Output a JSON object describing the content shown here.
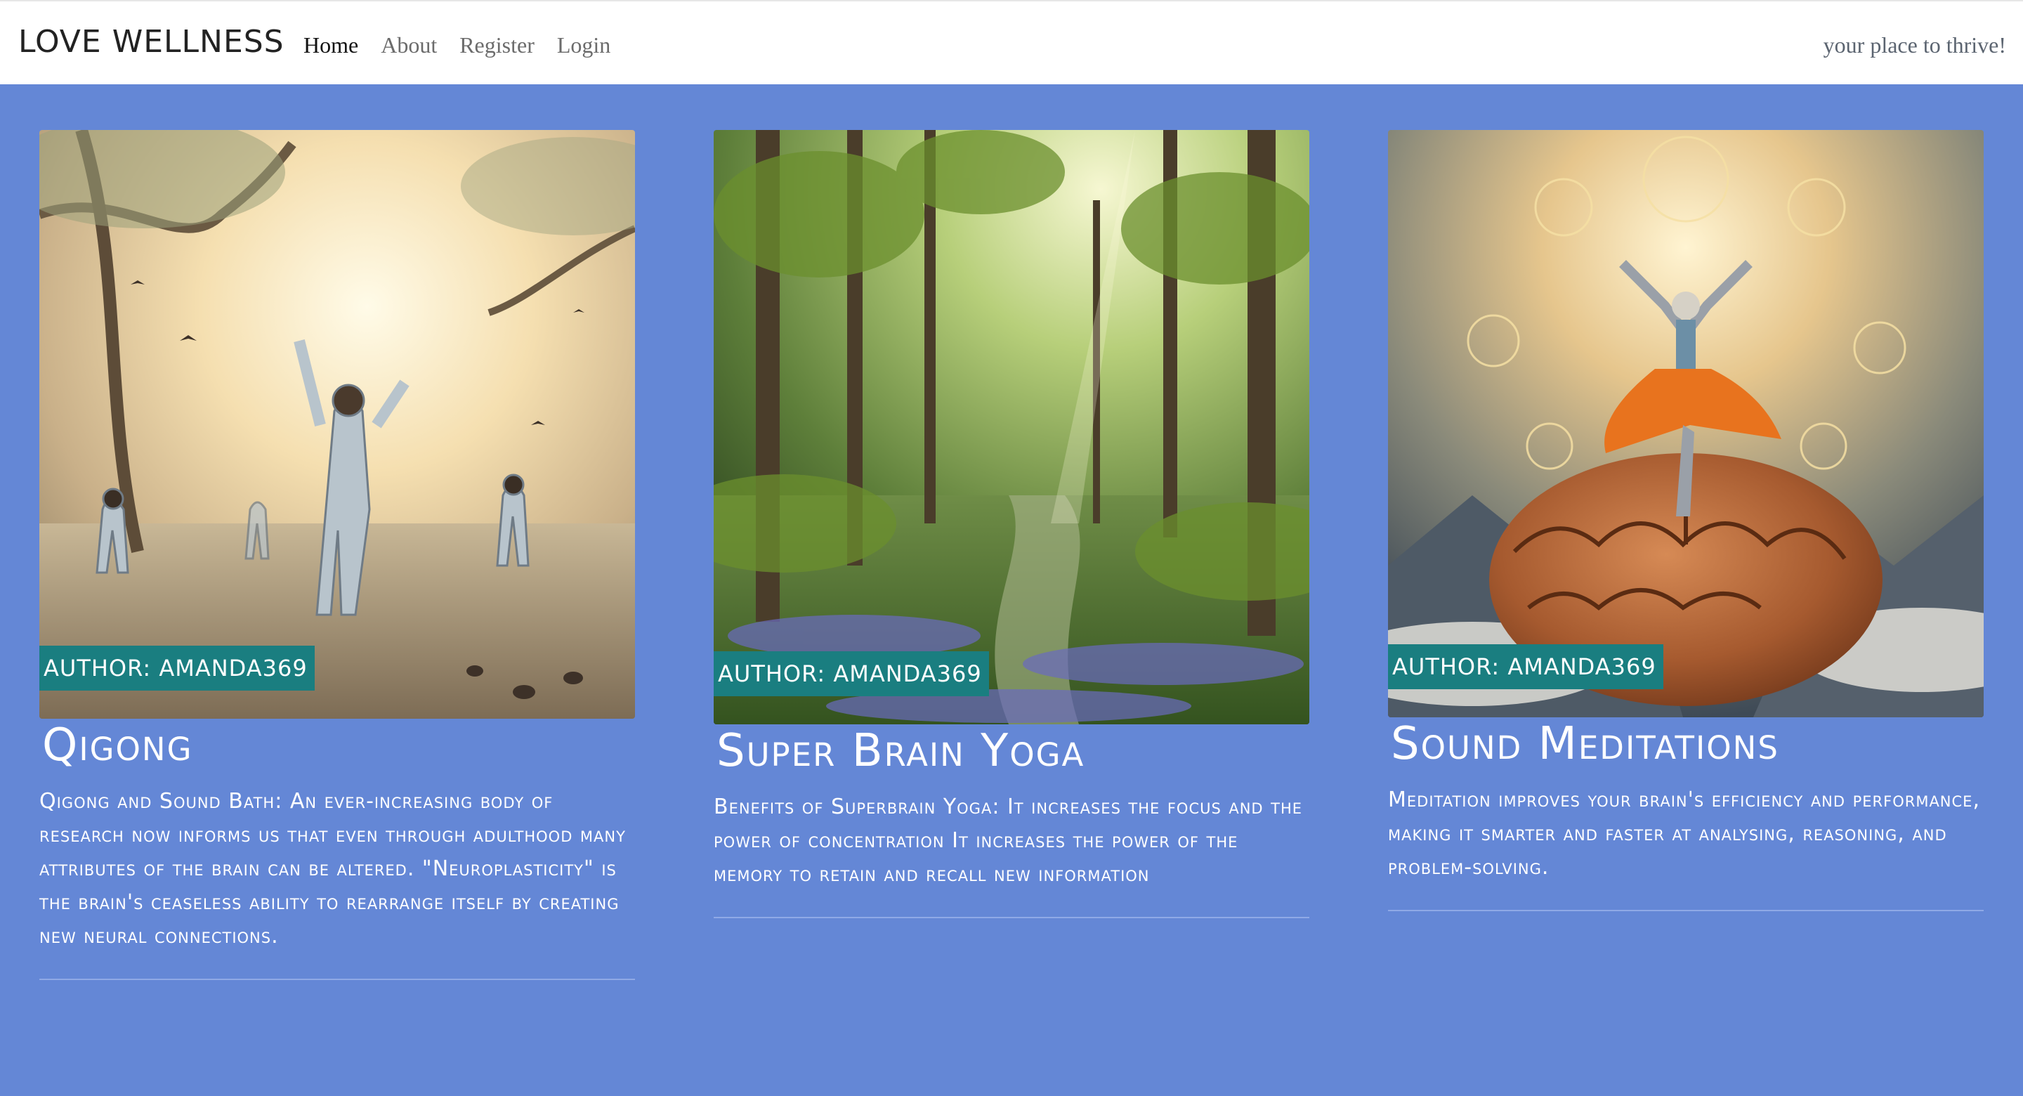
{
  "navbar": {
    "brand": "LOVE WELLNESS",
    "links": [
      {
        "label": "Home",
        "active": true
      },
      {
        "label": "About",
        "active": false
      },
      {
        "label": "Register",
        "active": false
      },
      {
        "label": "Login",
        "active": false
      }
    ],
    "tagline": "your place to thrive!"
  },
  "posts": [
    {
      "title": "Qigong",
      "author": "AUTHOR: AMANDA369",
      "excerpt": "Qigong and Sound Bath: An ever-increasing body of research now informs us that even through adulthood many attributes of the brain can be altered. \"Neuroplasticity\" is the brain's ceaseless ability to rearrange itself by creating new neural connections."
    },
    {
      "title": "Super Brain Yoga",
      "author": "AUTHOR: AMANDA369",
      "excerpt": "Benefits of Superbrain Yoga: It increases the focus and the power of concentration It increases the power of the memory to retain and recall new information"
    },
    {
      "title": "Sound Meditations",
      "author": "AUTHOR: AMANDA369",
      "excerpt": "Meditation improves your brain's efficiency and performance, making it smarter and faster at analysing, reasoning, and problem-solving."
    }
  ],
  "colors": {
    "page_background": "#6487d6",
    "author_badge": "#1a7e80",
    "navbar_background": "#ffffff"
  }
}
